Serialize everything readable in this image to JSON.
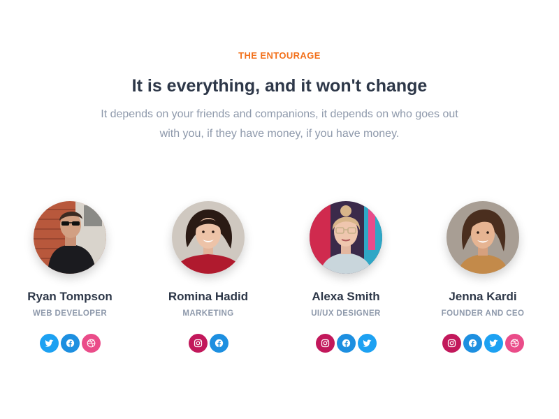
{
  "section": {
    "eyebrow": "THE ENTOURAGE",
    "title": "It is everything, and it won't change",
    "subtitle": "It depends on your friends and companions, it depends on who goes out with you, if they have money, if you have money."
  },
  "members": [
    {
      "name": "Ryan Tompson",
      "role": "WEB DEVELOPER",
      "socials": [
        "twitter-icon",
        "facebook-icon",
        "dribbble-icon"
      ]
    },
    {
      "name": "Romina Hadid",
      "role": "MARKETING",
      "socials": [
        "instagram-icon",
        "facebook-icon"
      ]
    },
    {
      "name": "Alexa Smith",
      "role": "UI/UX DESIGNER",
      "socials": [
        "instagram-icon",
        "facebook-icon",
        "twitter-icon"
      ]
    },
    {
      "name": "Jenna Kardi",
      "role": "FOUNDER AND CEO",
      "socials": [
        "instagram-icon",
        "facebook-icon",
        "twitter-icon",
        "dribbble-icon"
      ]
    }
  ],
  "colors": {
    "accent": "#f2711c",
    "heading": "#2d3748",
    "muted": "#8e99ab",
    "twitter": "#1da1f2",
    "facebook": "#1d8fe0",
    "dribbble": "#ea4c89",
    "instagram": "#c2185b"
  }
}
